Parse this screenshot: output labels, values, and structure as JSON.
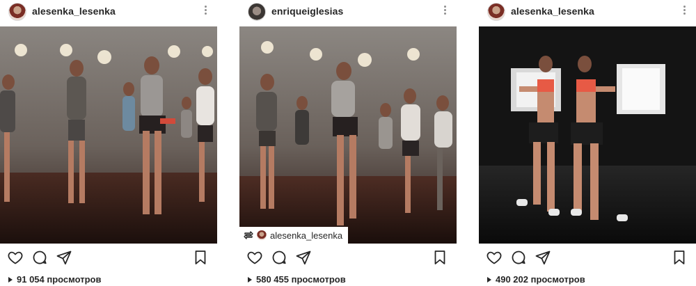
{
  "posts": [
    {
      "username": "alesenka_lesenka",
      "views": "91 054 просмотров"
    },
    {
      "username": "enriqueiglesias",
      "views": "580 455 просмотров",
      "repost_username": "alesenka_lesenka"
    },
    {
      "username": "alesenka_lesenka",
      "views": "490 202 просмотров"
    }
  ],
  "icons": {
    "like": "heart-icon",
    "comment": "comment-icon",
    "share": "share-icon",
    "save": "bookmark-icon",
    "more": "more-icon",
    "repost": "repost-icon",
    "views": "play-icon"
  },
  "colors": {
    "text": "#262626",
    "muted": "#8e8e8e",
    "border": "#dbdbdb"
  }
}
